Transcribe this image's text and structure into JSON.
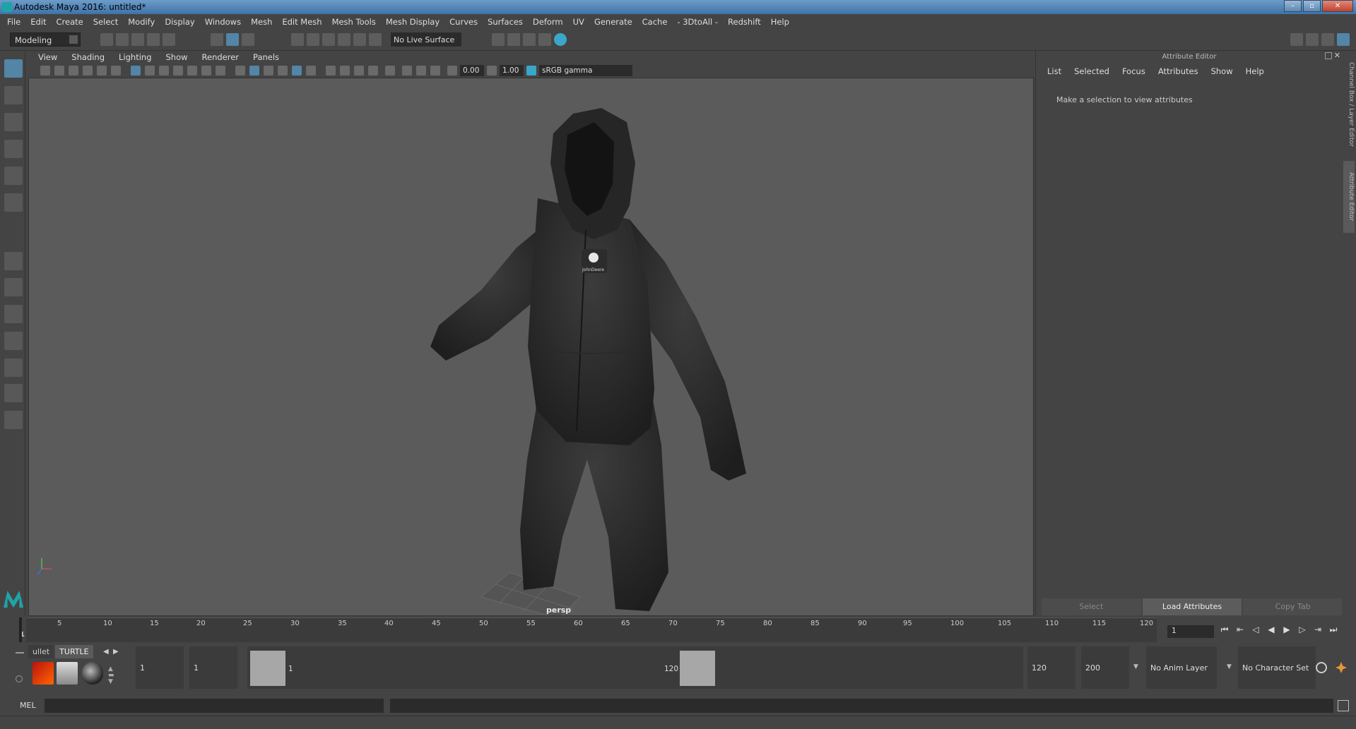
{
  "window": {
    "title": "Autodesk Maya 2016: untitled*"
  },
  "menubar": [
    "File",
    "Edit",
    "Create",
    "Select",
    "Modify",
    "Display",
    "Windows",
    "Mesh",
    "Edit Mesh",
    "Mesh Tools",
    "Mesh Display",
    "Curves",
    "Surfaces",
    "Deform",
    "UV",
    "Generate",
    "Cache",
    "- 3DtoAll -",
    "Redshift",
    "Help"
  ],
  "shelf": {
    "mode": "Modeling",
    "live_surface": "No Live Surface"
  },
  "viewport": {
    "menu": [
      "View",
      "Shading",
      "Lighting",
      "Show",
      "Renderer",
      "Panels"
    ],
    "exposure": "0.00",
    "gamma": "1.00",
    "color_space": "sRGB gamma",
    "camera_label": "persp",
    "model_logo": "JohnDeere"
  },
  "attribute_editor": {
    "title": "Attribute Editor",
    "menu": [
      "List",
      "Selected",
      "Focus",
      "Attributes",
      "Show",
      "Help"
    ],
    "message": "Make a selection to view attributes",
    "buttons": {
      "select": "Select",
      "load": "Load Attributes",
      "copy": "Copy Tab"
    },
    "side_tabs": [
      "Channel Box / Layer Editor",
      "Attribute Editor"
    ]
  },
  "timeline": {
    "start": "1",
    "ticks": [
      "5",
      "10",
      "15",
      "20",
      "25",
      "30",
      "35",
      "40",
      "45",
      "50",
      "55",
      "60",
      "65",
      "70",
      "75",
      "80",
      "85",
      "90",
      "95",
      "100",
      "105",
      "110",
      "115",
      "120"
    ],
    "current_frame": "1"
  },
  "range": {
    "shelf_tabs": [
      "ullet",
      "TURTLE"
    ],
    "start": "1",
    "playback_start": "1",
    "handle_start": "1",
    "handle_end": "120",
    "playback_end": "120",
    "end": "200",
    "anim_layer": "No Anim Layer",
    "character_set": "No Character Set"
  },
  "command_line": {
    "label": "MEL"
  }
}
